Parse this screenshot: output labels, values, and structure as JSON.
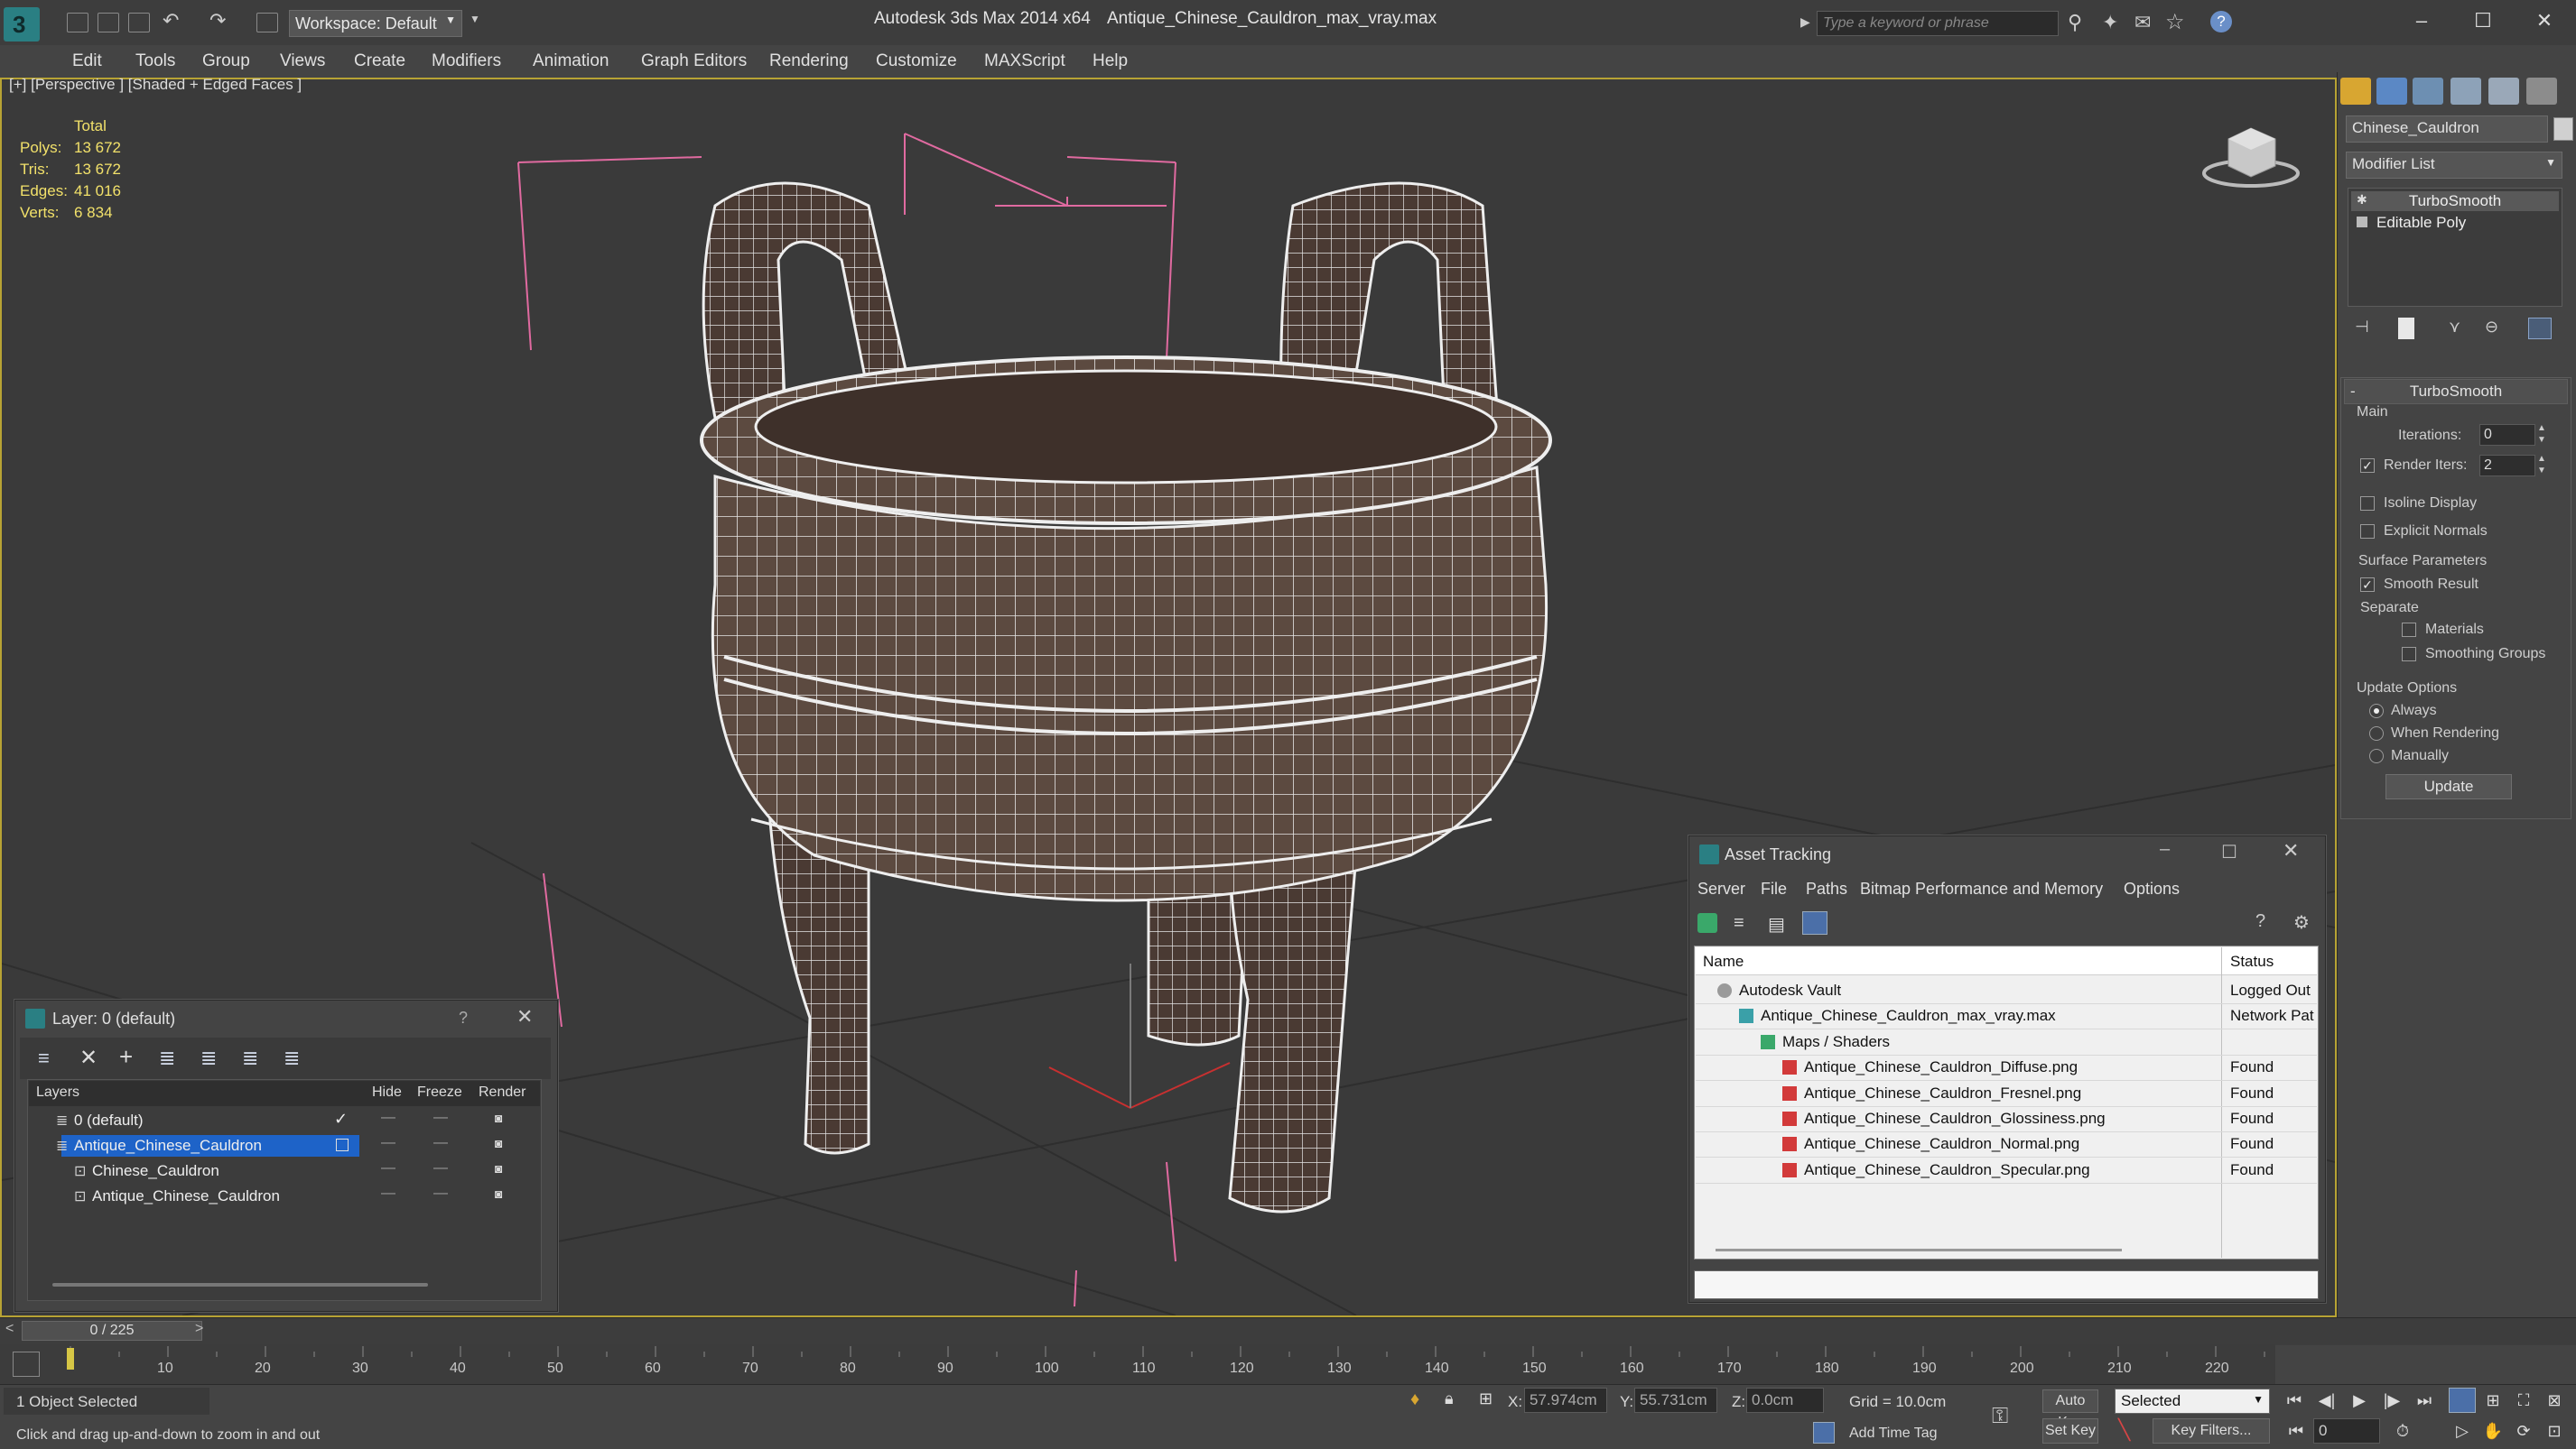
{
  "titlebar": {
    "workspace": "Workspace: Default",
    "app_name": "Autodesk 3ds Max  2014 x64",
    "file_name": "Antique_Chinese_Cauldron_max_vray.max",
    "search_placeholder": "Type a keyword or phrase"
  },
  "menu": [
    "Edit",
    "Tools",
    "Group",
    "Views",
    "Create",
    "Modifiers",
    "Animation",
    "Graph Editors",
    "Rendering",
    "Customize",
    "MAXScript",
    "Help"
  ],
  "viewport": {
    "label": "[+] [Perspective ] [Shaded + Edged Faces ]",
    "stats": {
      "header": "Total",
      "rows": [
        {
          "label": "Polys:",
          "value": "13 672"
        },
        {
          "label": "Tris:",
          "value": "13 672"
        },
        {
          "label": "Edges:",
          "value": "41 016"
        },
        {
          "label": "Verts:",
          "value": "6 834"
        }
      ]
    }
  },
  "command_panel": {
    "object_name": "Chinese_Cauldron",
    "modifier_list": "Modifier List",
    "stack": [
      "TurboSmooth",
      "Editable Poly"
    ],
    "turbosmooth": {
      "title": "TurboSmooth",
      "main": "Main",
      "iterations_label": "Iterations:",
      "iterations": "0",
      "render_iters_label": "Render Iters:",
      "render_iters": "2",
      "render_iters_checked": true,
      "isoline": "Isoline Display",
      "explicit_normals": "Explicit Normals",
      "surface_params": "Surface Parameters",
      "smooth_result": "Smooth Result",
      "separate": "Separate",
      "materials": "Materials",
      "smoothing_groups": "Smoothing Groups",
      "update_options": "Update Options",
      "always": "Always",
      "when_rendering": "When Rendering",
      "manually": "Manually",
      "update_button": "Update"
    }
  },
  "layer_window": {
    "title": "Layer: 0 (default)",
    "help": "?",
    "columns": [
      "Layers",
      "Hide",
      "Freeze",
      "Render"
    ],
    "rows": [
      {
        "name": "0 (default)",
        "indent": 0,
        "active": true,
        "selected": false
      },
      {
        "name": "Antique_Chinese_Cauldron",
        "indent": 0,
        "active": false,
        "selected": true
      },
      {
        "name": "Chinese_Cauldron",
        "indent": 1,
        "active": false,
        "selected": false
      },
      {
        "name": "Antique_Chinese_Cauldron",
        "indent": 1,
        "active": false,
        "selected": false
      }
    ]
  },
  "asset_window": {
    "title": "Asset Tracking",
    "menu": [
      "Server",
      "File",
      "Paths",
      "Bitmap Performance and Memory",
      "Options"
    ],
    "columns": [
      "Name",
      "Status"
    ],
    "rows": [
      {
        "name": "Autodesk Vault",
        "status": "Logged Out",
        "indent": 1,
        "icon": "vault-icon"
      },
      {
        "name": "Antique_Chinese_Cauldron_max_vray.max",
        "status": "Network Pat",
        "indent": 2,
        "icon": "max-file-icon"
      },
      {
        "name": "Maps / Shaders",
        "status": "",
        "indent": 3,
        "icon": "maps-icon"
      },
      {
        "name": "Antique_Chinese_Cauldron_Diffuse.png",
        "status": "Found",
        "indent": 4,
        "icon": "png-icon"
      },
      {
        "name": "Antique_Chinese_Cauldron_Fresnel.png",
        "status": "Found",
        "indent": 4,
        "icon": "png-icon"
      },
      {
        "name": "Antique_Chinese_Cauldron_Glossiness.png",
        "status": "Found",
        "indent": 4,
        "icon": "png-icon"
      },
      {
        "name": "Antique_Chinese_Cauldron_Normal.png",
        "status": "Found",
        "indent": 4,
        "icon": "png-icon"
      },
      {
        "name": "Antique_Chinese_Cauldron_Specular.png",
        "status": "Found",
        "indent": 4,
        "icon": "png-icon"
      }
    ]
  },
  "timeline": {
    "frame": "0 / 225",
    "ticks": [
      "10",
      "20",
      "30",
      "40",
      "50",
      "60",
      "70",
      "80",
      "90",
      "100",
      "110",
      "120",
      "130",
      "140",
      "150",
      "160",
      "170",
      "180",
      "190",
      "200",
      "210",
      "220"
    ]
  },
  "status": {
    "selection": "1 Object Selected",
    "prompt": "Click and drag up-and-down to zoom in and out",
    "x_label": "X:",
    "x": "57.974cm",
    "y_label": "Y:",
    "y": "55.731cm",
    "z_label": "Z:",
    "z": "0.0cm",
    "grid": "Grid = 10.0cm",
    "auto_key": "Auto Key",
    "selected_set": "Selected",
    "set_key": "Set Key",
    "key_filters": "Key Filters...",
    "add_time_tag": "Add Time Tag",
    "frame_field": "0"
  },
  "colors": {
    "viewport_border": "#b7a334",
    "stats_text": "#f2e16a",
    "selection_blue": "#1e63c8",
    "trackbar_marker": "#d6c645"
  }
}
